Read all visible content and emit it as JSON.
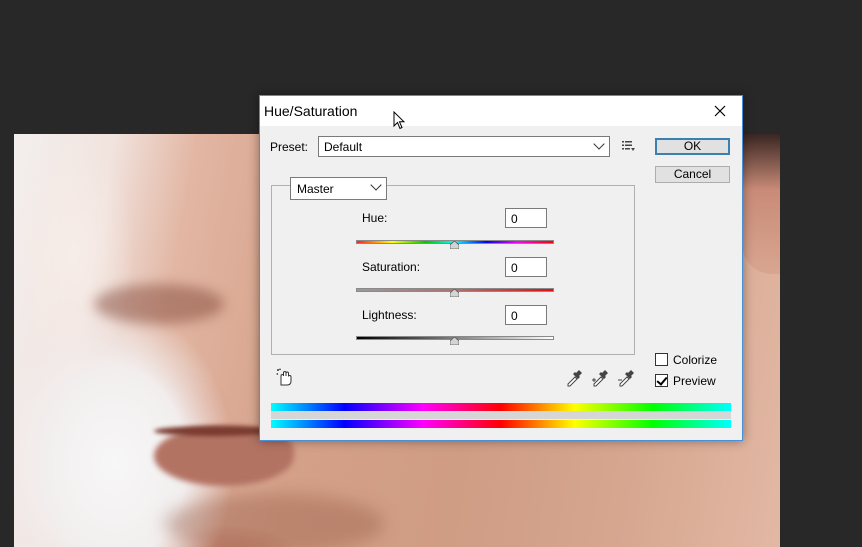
{
  "dialog": {
    "title": "Hue/Saturation",
    "close_icon": "close-icon",
    "preset": {
      "label": "Preset:",
      "value": "Default"
    },
    "ok_label": "OK",
    "cancel_label": "Cancel",
    "channel": {
      "value": "Master"
    },
    "hue": {
      "label": "Hue:",
      "value": "0"
    },
    "saturation": {
      "label": "Saturation:",
      "value": "0"
    },
    "lightness": {
      "label": "Lightness:",
      "value": "0"
    },
    "colorize": {
      "label": "Colorize",
      "checked": false
    },
    "preview": {
      "label": "Preview",
      "checked": true
    },
    "icons": [
      "preset-menu-icon",
      "targeted-adjustment-hand-icon",
      "eyedropper-icon",
      "eyedropper-plus-icon",
      "eyedropper-minus-icon"
    ]
  },
  "colors": {
    "app_background": "#282828",
    "dialog_border": "#4a90d9",
    "ok_border": "#3c7fb1"
  }
}
